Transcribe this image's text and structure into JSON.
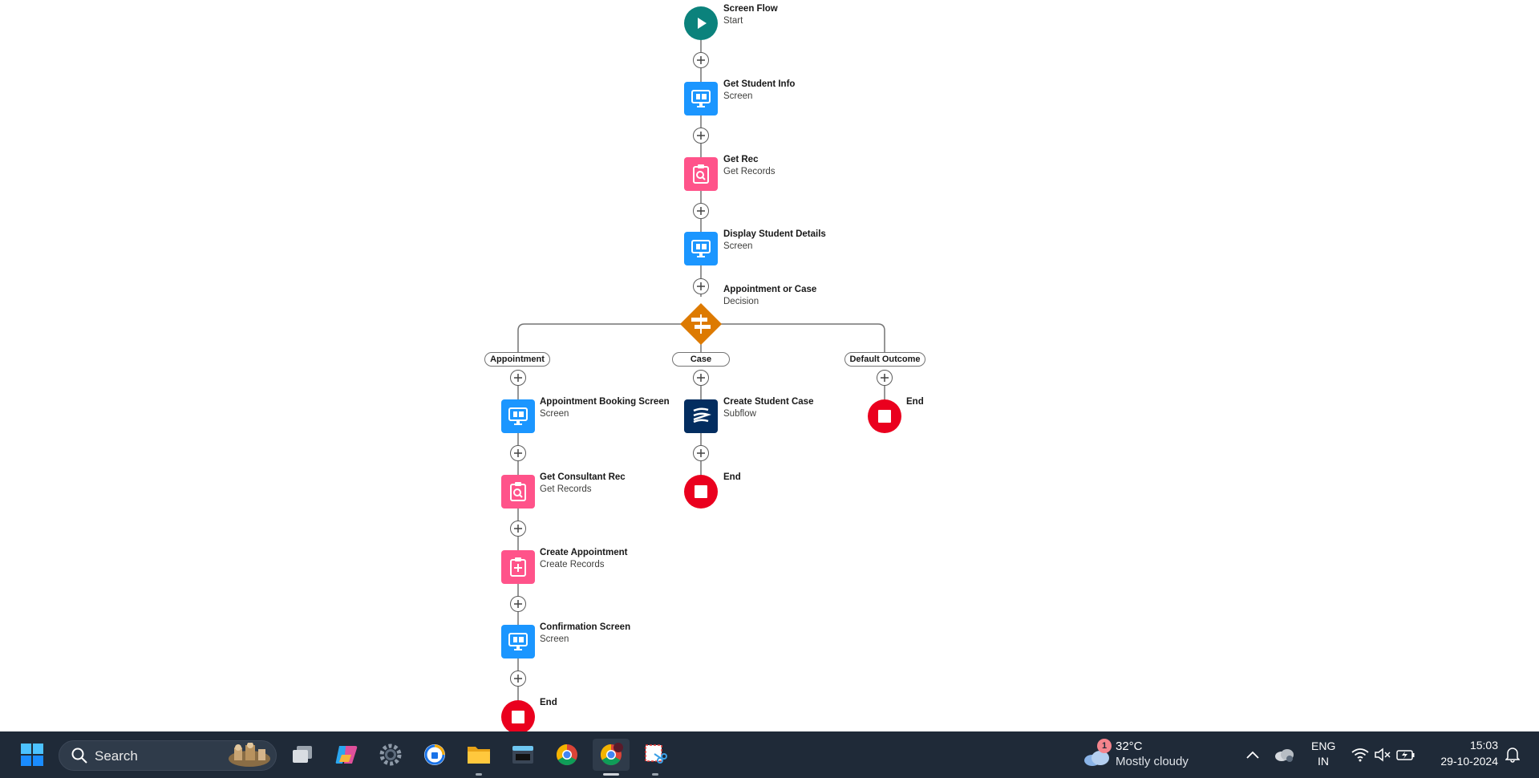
{
  "flow": {
    "start": {
      "title": "Screen Flow",
      "subtitle": "Start"
    },
    "get_student_info": {
      "title": "Get Student Info",
      "subtitle": "Screen"
    },
    "get_rec": {
      "title": "Get Rec",
      "subtitle": "Get Records"
    },
    "display_student_details": {
      "title": "Display Student Details",
      "subtitle": "Screen"
    },
    "decision": {
      "title": "Appointment or Case",
      "subtitle": "Decision"
    },
    "outcomes": {
      "appointment": "Appointment",
      "case": "Case",
      "default": "Default Outcome"
    },
    "appointment_branch": {
      "booking": {
        "title": "Appointment Booking Screen",
        "subtitle": "Screen"
      },
      "get_consultant": {
        "title": "Get Consultant Rec",
        "subtitle": "Get Records"
      },
      "create_appointment": {
        "title": "Create Appointment",
        "subtitle": "Create Records"
      },
      "confirmation": {
        "title": "Confirmation Screen",
        "subtitle": "Screen"
      },
      "end": "End"
    },
    "case_branch": {
      "create_case": {
        "title": "Create Student Case",
        "subtitle": "Subflow"
      },
      "end": "End"
    },
    "default_branch": {
      "end": "End"
    }
  },
  "taskbar": {
    "search_placeholder": "Search",
    "weather": {
      "temp": "32°C",
      "condition": "Mostly cloudy",
      "badge": "1"
    },
    "language": {
      "line1": "ENG",
      "line2": "IN"
    },
    "clock": {
      "time": "15:03",
      "date": "29-10-2024"
    },
    "icons": [
      "windows-start-icon",
      "search-icon",
      "task-view-icon",
      "copilot-icon",
      "settings-icon",
      "vpn-icon",
      "file-explorer-icon",
      "terminal-icon",
      "chrome-icon",
      "chrome-profile-icon",
      "snipping-tool-icon"
    ]
  },
  "colors": {
    "start": "#0b827c",
    "screen": "#1b96ff",
    "records": "#ff538a",
    "decision": "#dd7a01",
    "subflow": "#032d60",
    "end": "#ea001e",
    "taskbar": "#1f2a38"
  }
}
